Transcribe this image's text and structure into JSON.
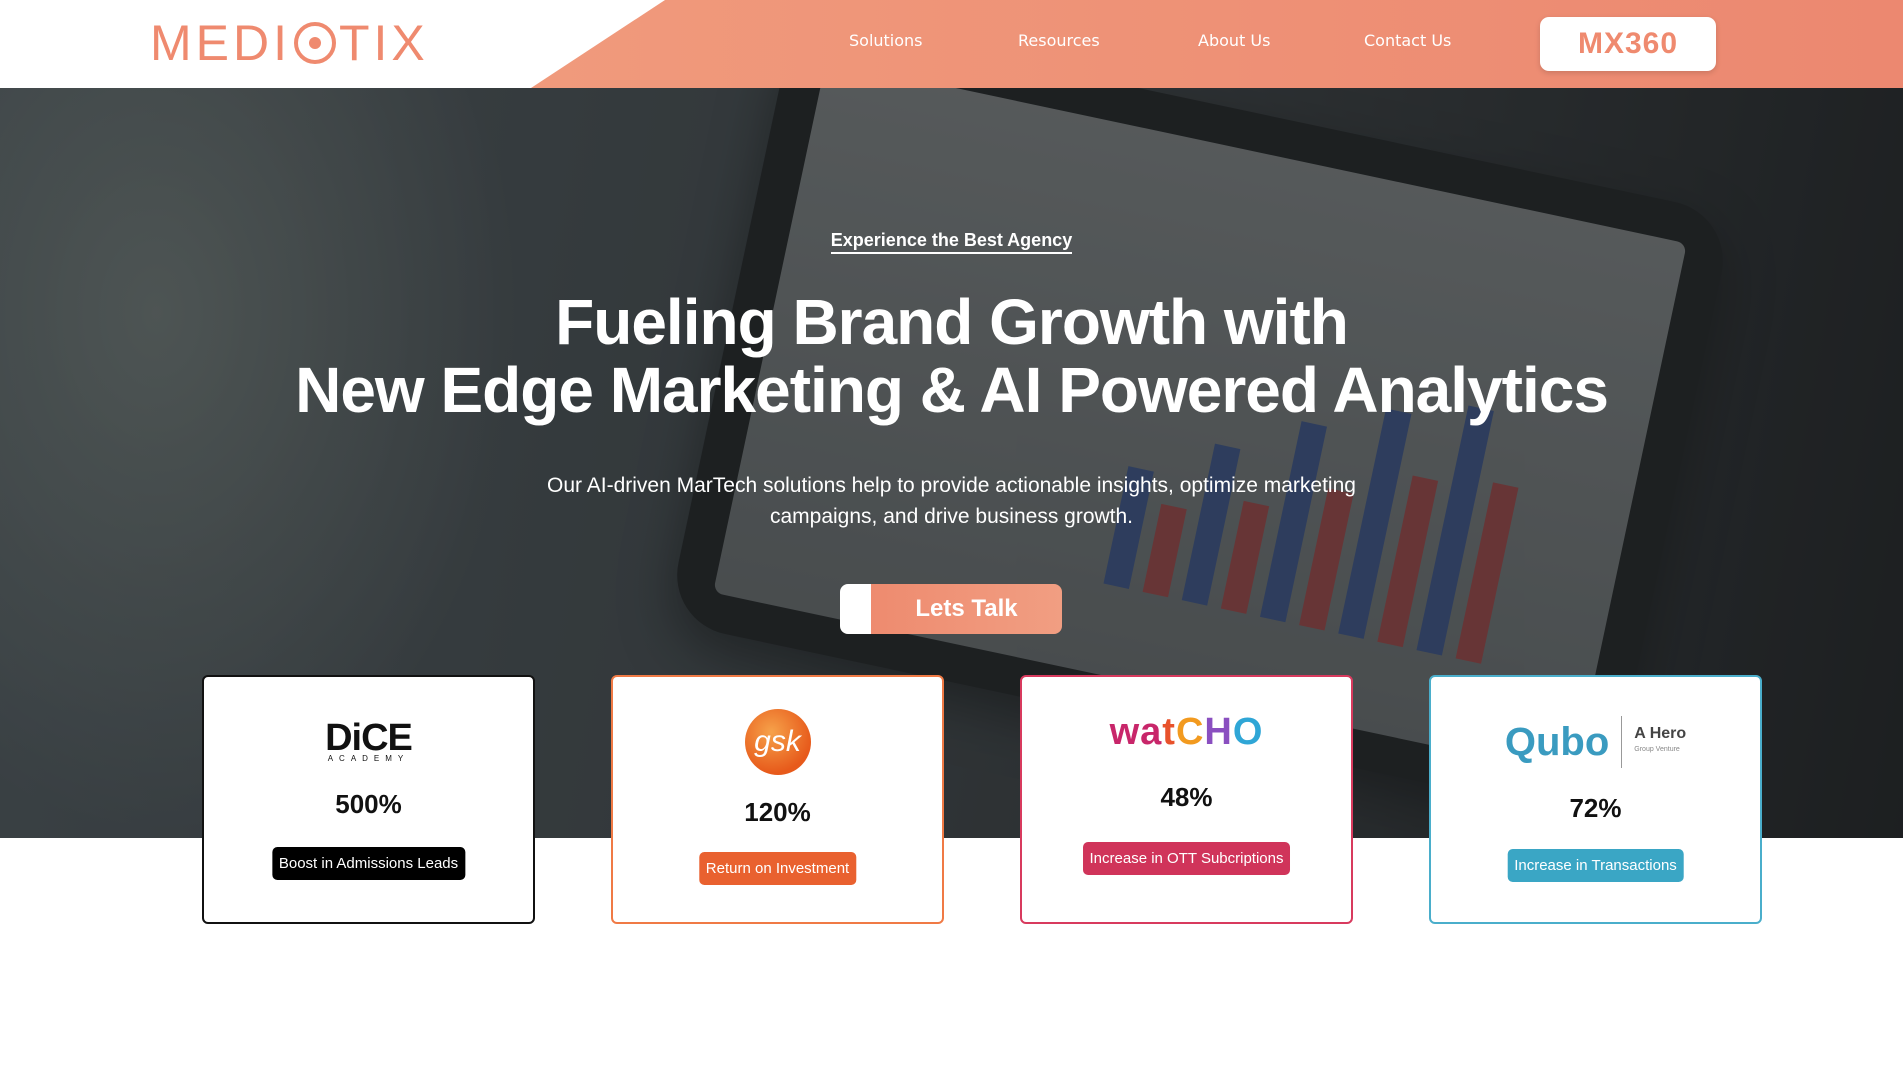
{
  "brand": {
    "logo_text_pre": "MEDI",
    "logo_text_post": "TIX",
    "accent_color": "#ef8a6f"
  },
  "nav": {
    "items": [
      {
        "label": "Solutions"
      },
      {
        "label": "Resources"
      },
      {
        "label": "About Us"
      },
      {
        "label": "Contact Us"
      }
    ],
    "product_button": "MX360"
  },
  "hero": {
    "eyebrow": "Experience the Best Agency",
    "headline_line1": "Fueling Brand Growth with",
    "headline_line2": "New Edge Marketing & AI Powered Analytics",
    "subtitle_line1": "Our AI-driven MarTech solutions help to provide actionable insights, optimize marketing",
    "subtitle_line2": "campaigns, and drive business growth.",
    "cta_label": "Lets Talk"
  },
  "cards": [
    {
      "brand": "DiCE",
      "brand_sub": "ACADEMY",
      "value": "500%",
      "label": "Boost in Admissions Leads",
      "border_color": "#111111",
      "badge_color": "#000000"
    },
    {
      "brand": "gsk",
      "value": "120%",
      "label": "Return on Investment",
      "border_color": "#f07a45",
      "badge_color": "#e9612f"
    },
    {
      "brand": "watCHO",
      "value": "48%",
      "label": "Increase in OTT Subcriptions",
      "border_color": "#d83a5e",
      "badge_color": "#d0345a"
    },
    {
      "brand": "Qubo",
      "brand_partner": "A Hero",
      "brand_partner_sub": "Group Venture",
      "value": "72%",
      "label": "Increase in Transactions",
      "border_color": "#4aaecb",
      "badge_color": "#3aa6c5"
    }
  ]
}
